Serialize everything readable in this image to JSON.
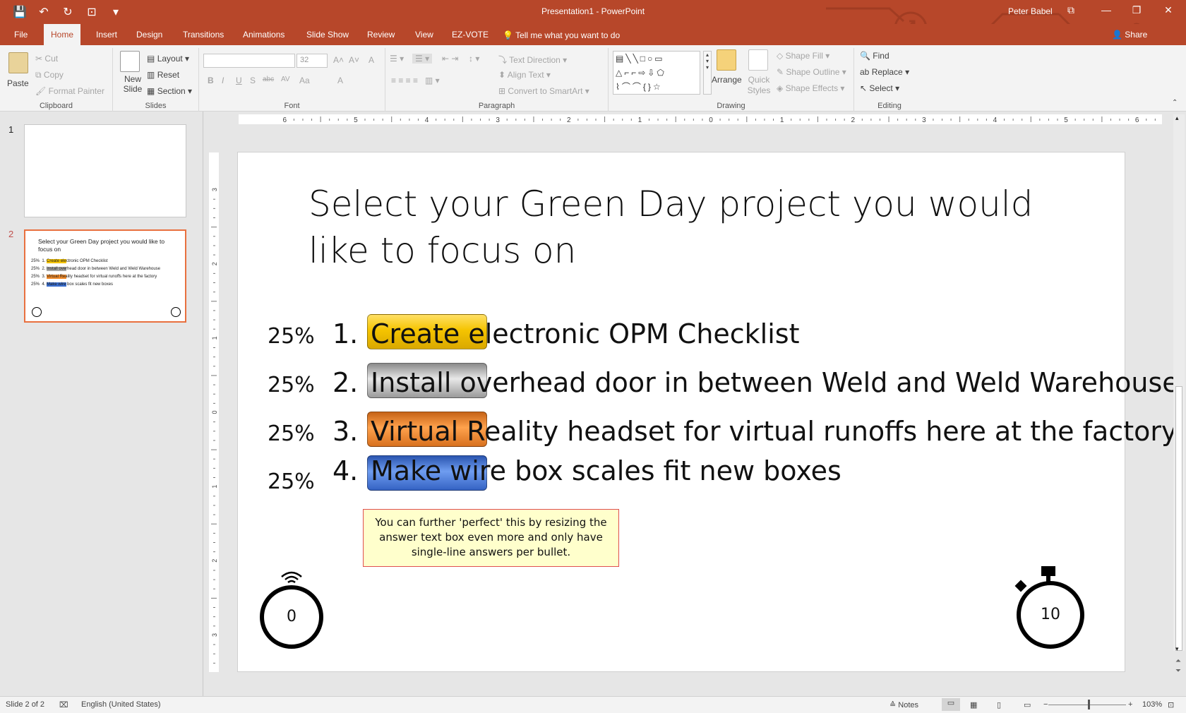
{
  "app": {
    "doc_title": "Presentation1 - PowerPoint",
    "user": "Peter Babel"
  },
  "qat": {
    "save": "💾",
    "undo": "↶",
    "redo": "↻",
    "present": "⊡",
    "more": "▾"
  },
  "window": {
    "ribbon_options": "⧉",
    "minimize": "—",
    "restore": "❐",
    "close": "✕"
  },
  "tabs": [
    "File",
    "Home",
    "Insert",
    "Design",
    "Transitions",
    "Animations",
    "Slide Show",
    "Review",
    "View",
    "EZ-VOTE"
  ],
  "tell_me": "Tell me what you want to do",
  "share": "Share",
  "ribbon": {
    "clipboard": {
      "label": "Clipboard",
      "paste": "Paste",
      "cut": "Cut",
      "copy": "Copy",
      "format_painter": "Format Painter"
    },
    "slides": {
      "label": "Slides",
      "new_slide": "New Slide",
      "layout": "Layout",
      "reset": "Reset",
      "section": "Section"
    },
    "font": {
      "label": "Font",
      "font_name": "",
      "font_size": "32",
      "bold": "B",
      "italic": "I",
      "underline": "U",
      "shadow": "S",
      "strike": "abc",
      "spacing": "AV",
      "case": "Aa",
      "color": "A",
      "grow": "A˄",
      "shrink": "A˅",
      "clear": "A"
    },
    "paragraph": {
      "label": "Paragraph",
      "text_direction": "Text Direction",
      "align_text": "Align Text",
      "convert_smartart": "Convert to SmartArt"
    },
    "drawing": {
      "label": "Drawing",
      "arrange": "Arrange",
      "quick_styles": "Quick Styles",
      "shape_fill": "Shape Fill",
      "shape_outline": "Shape Outline",
      "shape_effects": "Shape Effects",
      "shapes_glyphs": "▤╲╲□○▭ △⌐⌐⇨⇩⬠ ⌇⌒⌒{}☆"
    },
    "editing": {
      "label": "Editing",
      "find": "Find",
      "replace": "Replace",
      "select": "Select"
    }
  },
  "thumbnails": [
    {
      "num": "1"
    },
    {
      "num": "2",
      "title": "Select your Green Day project you would like to focus on",
      "items": [
        "Create electronic OPM Checklist",
        "Install overhead door in between Weld and Weld Warehouse",
        "Virtual Reality headset for virtual runoffs here at the factory",
        "Make wire box scales fit new boxes"
      ]
    }
  ],
  "slide": {
    "title": "Select your Green Day project you would like to focus on",
    "answers": [
      {
        "pct": "25%",
        "num": "1.",
        "text": "Create electronic OPM Checklist",
        "color": "#f5c400"
      },
      {
        "pct": "25%",
        "num": "2.",
        "text": "Install overhead door in between Weld and Weld Warehouse",
        "color": "#a8a8a8"
      },
      {
        "pct": "25%",
        "num": "3.",
        "text": "Virtual Reality headset for virtual runoffs here at the factory",
        "color": "#f08a2a"
      },
      {
        "pct": "25%",
        "num": "4.",
        "text": "Make wire box scales fit new boxes",
        "color": "#3b6fd0"
      }
    ],
    "note": "You can further 'perfect' this by resizing the answer text box even more and only have single-line answers per bullet.",
    "response_counter": "0",
    "countdown": "10"
  },
  "ruler": {
    "h_labels": [
      "6",
      "5",
      "4",
      "3",
      "2",
      "1",
      "0",
      "1",
      "2",
      "3",
      "4",
      "5",
      "6"
    ],
    "v_labels": [
      "3",
      "2",
      "1",
      "0",
      "1",
      "2",
      "3"
    ]
  },
  "status": {
    "slide": "Slide 2 of 2",
    "language": "English (United States)",
    "notes": "Notes",
    "zoom": "103%"
  },
  "colors": {
    "accent": "#b7472a",
    "selection": "#e8703f"
  }
}
